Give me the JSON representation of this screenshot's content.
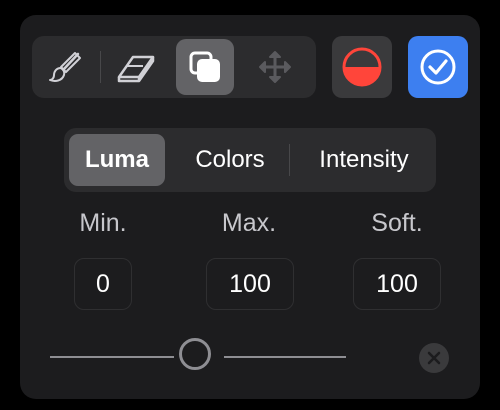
{
  "toolbar": {
    "tools": [
      {
        "name": "brush",
        "active": false
      },
      {
        "name": "eraser",
        "active": false
      },
      {
        "name": "clone",
        "active": true
      },
      {
        "name": "move",
        "active": false
      }
    ],
    "mask_button_color": "#ff453a",
    "apply_button_color": "#3d7ff0"
  },
  "segments": {
    "items": [
      "Luma",
      "Colors",
      "Intensity"
    ],
    "selected": "Luma"
  },
  "range": {
    "min_label": "Min.",
    "max_label": "Max.",
    "soft_label": "Soft.",
    "min_value": "0",
    "max_value": "100",
    "soft_value": "100"
  },
  "slider": {
    "position": 0.5
  },
  "icons": [
    "brush-icon",
    "eraser-icon",
    "clone-icon",
    "move-icon",
    "mask-icon",
    "checkmark-icon",
    "close-icon"
  ]
}
